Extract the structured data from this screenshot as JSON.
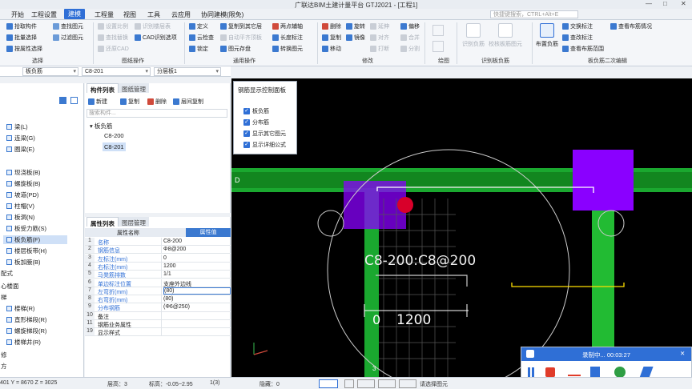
{
  "window": {
    "title": "广联达BIM土建计量平台 GTJ2021 - [工程1]",
    "min": "—",
    "max": "□",
    "close": "✕"
  },
  "menu": [
    "开始",
    "工程设置",
    "建模",
    "工程量",
    "视图",
    "工具",
    "云应用",
    "协同建模(限免)"
  ],
  "search_placeholder": "快捷键搜索，CTRL+Alt+E",
  "ribbon": {
    "select": [
      "拾取构件",
      "批量选择",
      "按属性选择"
    ],
    "select_extra": [
      "查找图元",
      "过滤图元"
    ],
    "select_group": "选择",
    "select_tooltip": "开始",
    "drawing": [
      "设置比例",
      "查找替换",
      "还原CAD",
      "识别楼层表",
      "CAD识别选项"
    ],
    "drawing_group": "图纸操作",
    "common": [
      "定义",
      "云检查",
      "锁定",
      "复制到其它层",
      "自动平齐顶板",
      "图元存盘",
      "两点辅轴",
      "长度标注",
      "转换图元"
    ],
    "common_group": "通用操作",
    "modify": [
      "删除",
      "复制",
      "移动",
      "旋转",
      "镜像",
      "对齐",
      "延伸",
      "打断",
      "偏移",
      "合并",
      "分割"
    ],
    "modify_group": "修改",
    "draw_group": "绘图",
    "identify": [
      "识别负筋",
      "校核板筋图元"
    ],
    "identify_group": "识别板负筋",
    "layout": [
      "布置负筋",
      "交换标注",
      "查改标注",
      "查看布筋范围",
      "查看布筋情况"
    ],
    "layout_group": "板负筋二次编辑"
  },
  "toolbar2": {
    "type": "板负筋",
    "name": "C8-201",
    "layer": "分层板1"
  },
  "leftnav": {
    "items": [
      "梁(L)",
      "连梁(G)",
      "圈梁(E)",
      "现浇板(B)",
      "螺旋板(B)",
      "坡道(PD)",
      "柱帽(V)",
      "板洞(N)",
      "板受力筋(S)",
      "板负筋(F)",
      "楼层板带(H)",
      "板加腋(B)"
    ],
    "sections": [
      "配式",
      "心楼面",
      "梯",
      "楼梯(R)",
      "直形梯段(R)",
      "螺旋梯段(R)",
      "楼梯井(R)",
      "修",
      "方"
    ],
    "selected": "板负筋(F)"
  },
  "components": {
    "tabs": [
      "构件列表",
      "图纸管理"
    ],
    "toolbar": [
      "新建",
      "复制",
      "删除",
      "层间复制"
    ],
    "search_placeholder": "搜索构件...",
    "group": "板负筋",
    "items": [
      "C8-200",
      "C8-201"
    ],
    "selected": "C8-201"
  },
  "properties": {
    "tabs": [
      "属性列表",
      "图层管理"
    ],
    "header": [
      "属性名称",
      "属性值"
    ],
    "rows": [
      {
        "n": "1",
        "k": "名称",
        "v": "C8-200"
      },
      {
        "n": "2",
        "k": "钢筋信息",
        "v": "Φ8@200"
      },
      {
        "n": "3",
        "k": "左标注(mm)",
        "v": "0"
      },
      {
        "n": "4",
        "k": "右标注(mm)",
        "v": "1200"
      },
      {
        "n": "5",
        "k": "马凳筋排数",
        "v": "1/1"
      },
      {
        "n": "6",
        "k": "单边标注位置",
        "v": "支座外边线"
      },
      {
        "n": "7",
        "k": "左弯折(mm)",
        "v": "(80)"
      },
      {
        "n": "8",
        "k": "右弯折(mm)",
        "v": "(80)"
      },
      {
        "n": "9",
        "k": "分布钢筋",
        "v": "(Φ6@250)"
      },
      {
        "n": "10",
        "k": "备注",
        "v": ""
      },
      {
        "n": "11",
        "k": "钢筋业务属性",
        "v": ""
      },
      {
        "n": "19",
        "k": "显示样式",
        "v": ""
      }
    ]
  },
  "panel": {
    "title": "钢筋显示控制面板",
    "items": [
      "板负筋",
      "分布筋",
      "显示其它图元",
      "显示详细公式"
    ]
  },
  "canvas": {
    "label": "C8-200:C8@200",
    "dim": "1200",
    "dim_left": "0",
    "axis": "D",
    "bottom_mark": "3"
  },
  "status": {
    "coords": "401 Y = 8670 Z = 3025",
    "floor": "层高：3",
    "elev": "标高：-0.05~2.95",
    "count": "1(3)",
    "hidden": "隐藏：0",
    "hint": "请选择图元"
  },
  "recorder": {
    "title": "录制中... 00:03:27"
  },
  "colors": {
    "accent": "#2f6fd6",
    "purple": "#8a00ff",
    "green": "#22bb33"
  }
}
